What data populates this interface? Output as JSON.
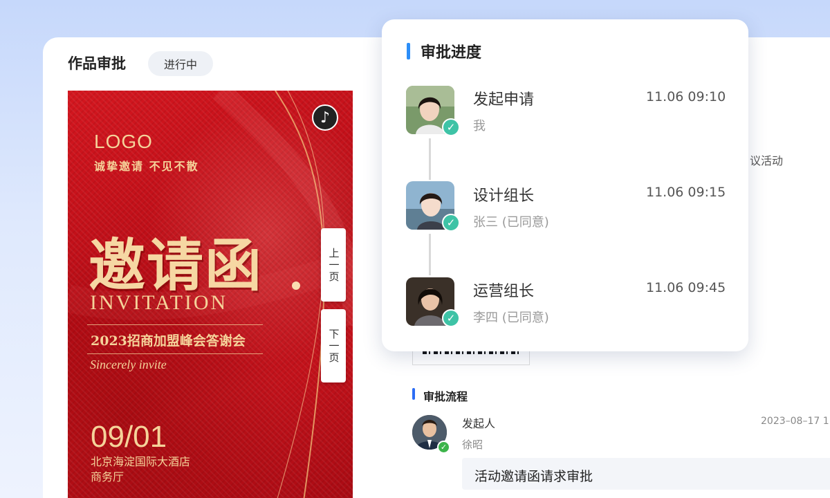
{
  "page": {
    "title": "作品审批",
    "status": "进行中"
  },
  "poster": {
    "logo": "LOGO",
    "slogan": "诚挚邀请 不见不散",
    "title": "邀请函",
    "title_en": "INVITATION",
    "event": "2023招商加盟峰会答谢会",
    "sincerely": "Sincerely invite",
    "date": "09/01",
    "venue_line1": "北京海淀国际大酒店",
    "venue_line2": "商务厅",
    "music_icon": "music-note-icon",
    "prev_page": "上一页",
    "next_page": "下一页"
  },
  "background": {
    "activity_fragment": "议活动",
    "flow_title": "审批流程",
    "initiator_role": "发起人",
    "initiator_name": "徐昭",
    "initiator_time": "2023–08–17 1",
    "comment": "活动邀请函请求审批"
  },
  "popup": {
    "title": "审批进度",
    "steps": [
      {
        "name": "发起申请",
        "sub": "我",
        "time": "11.06 09:10"
      },
      {
        "name": "设计组长",
        "sub": "张三 (已同意)",
        "time": "11.06 09:15"
      },
      {
        "name": "运营组长",
        "sub": "李四 (已同意)",
        "time": "11.06 09:45"
      }
    ]
  },
  "colors": {
    "accent": "#2c6df5",
    "check": "#3ec3a6",
    "poster_red": "#c3121b",
    "poster_gold": "#f5d39a"
  }
}
